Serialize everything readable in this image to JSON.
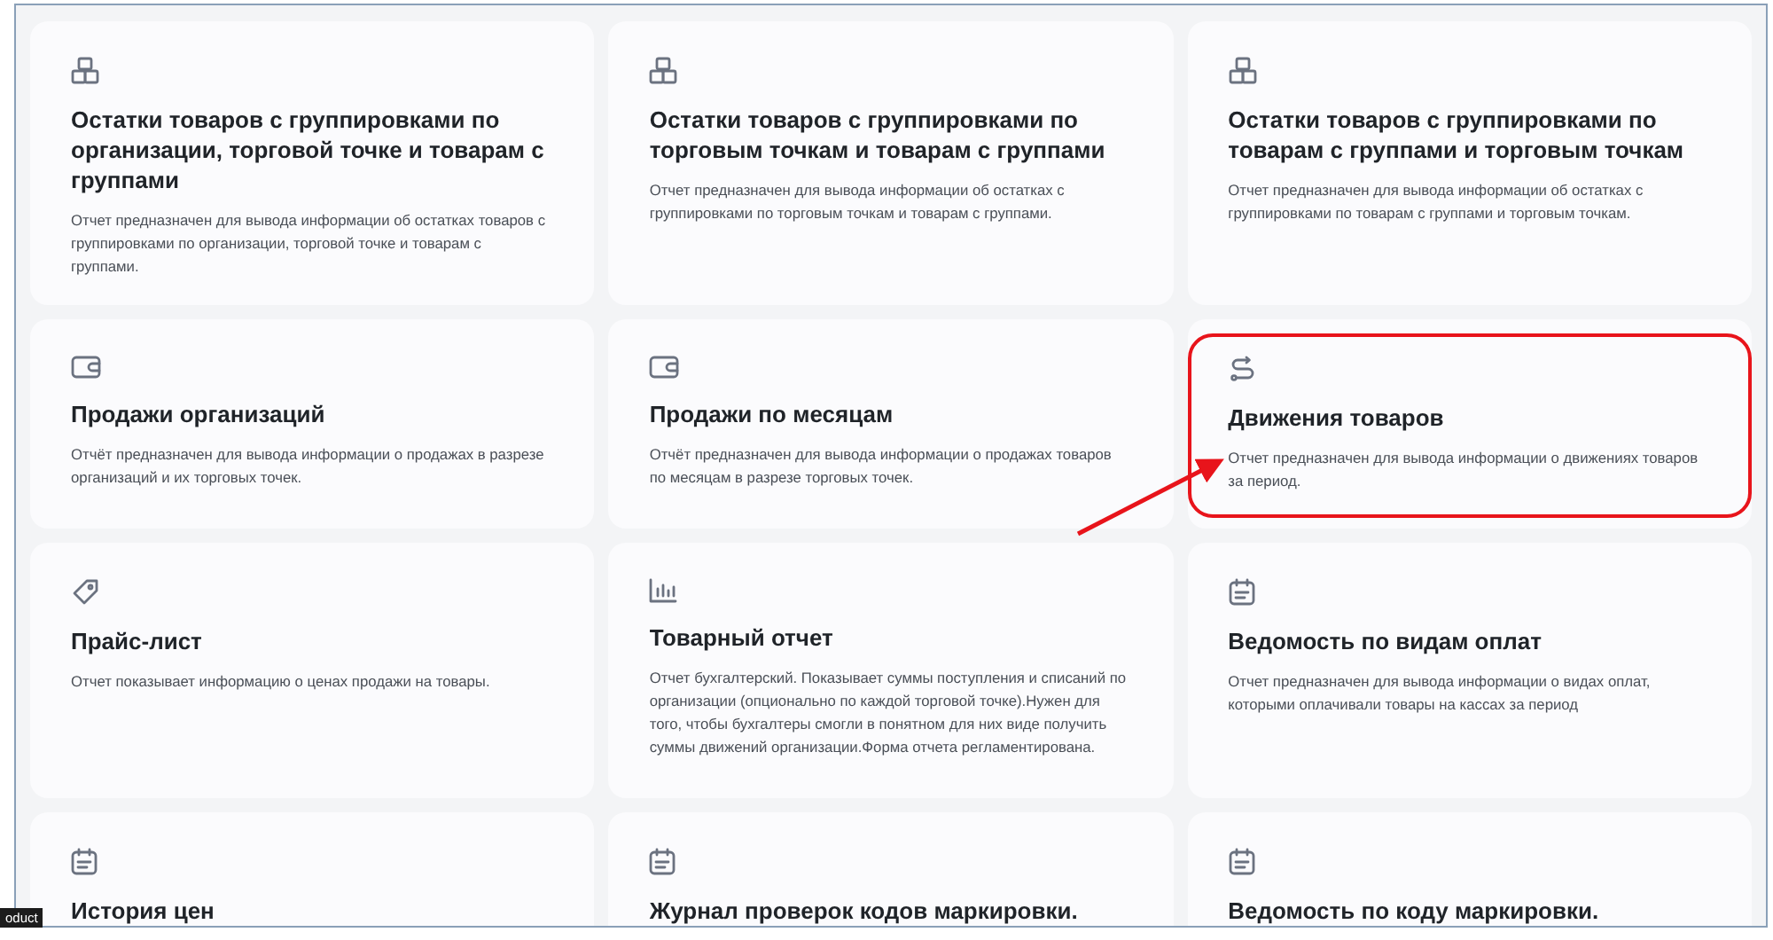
{
  "cards": [
    {
      "kind": "boxes",
      "title": "Остатки товаров с группировками по организации, торговой точке и товарам с группами",
      "description": "Отчет предназначен для вывода информации об остатках товаров с группировками по организации, торговой точке и товарам с группами.",
      "highlighted": false
    },
    {
      "kind": "boxes",
      "title": "Остатки товаров с группировками по торговым точкам и товарам с группами",
      "description": "Отчет предназначен для вывода информации об остатках с группировками по торговым точкам и товарам с группами.",
      "highlighted": false
    },
    {
      "kind": "boxes",
      "title": "Остатки товаров с группировками по товарам с группами и торговым точкам",
      "description": "Отчет предназначен для вывода информации об остатках с группировками по товарам с группами и торговым точкам.",
      "highlighted": false
    },
    {
      "kind": "wallet",
      "title": "Продажи организаций",
      "description": "Отчёт предназначен для вывода информации о продажах в разрезе организаций и их торговых точек.",
      "highlighted": false
    },
    {
      "kind": "wallet",
      "title": "Продажи по месяцам",
      "description": "Отчёт предназначен для вывода информации о продажах товаров по месяцам в разрезе торговых точек.",
      "highlighted": false
    },
    {
      "kind": "route",
      "title": "Движения товаров",
      "description": "Отчет предназначен для вывода информации о движениях товаров за период.",
      "highlighted": true
    },
    {
      "kind": "tag",
      "title": "Прайс-лист",
      "description": "Отчет показывает информацию о ценах продажи на товары.",
      "highlighted": false
    },
    {
      "kind": "chart",
      "title": "Товарный отчет",
      "description": "Отчет бухгалтерский. Показывает суммы поступления и списаний по организации (опционально по каждой торговой точке).Нужен для того, чтобы бухгалтеры смогли в понятном для них виде получить суммы движений организации.Форма отчета регламентирована.",
      "highlighted": false
    },
    {
      "kind": "calendar",
      "title": "Ведомость по видам оплат",
      "description": "Отчет предназначен для вывода информации о видах оплат, которыми оплачивали товары на кассах за период",
      "highlighted": false
    },
    {
      "kind": "calendar",
      "title": "История цен",
      "highlighted": false
    },
    {
      "kind": "calendar",
      "title": "Журнал проверок кодов маркировки.",
      "highlighted": false
    },
    {
      "kind": "calendar",
      "title": "Ведомость по коду маркировки.",
      "highlighted": false
    }
  ],
  "tooltip": "oduct"
}
